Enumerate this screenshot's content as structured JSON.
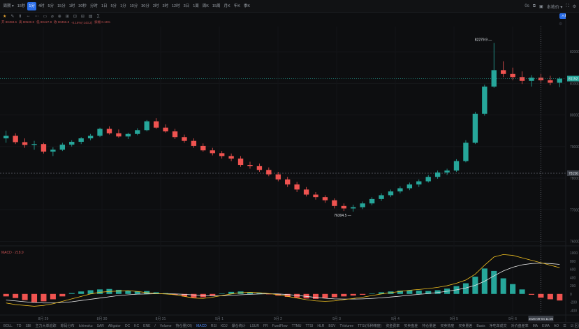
{
  "toolbar": {
    "periods": [
      "周期 ▾",
      "15秒",
      "1分",
      "4时",
      "5分",
      "15分",
      "1时",
      "30秒",
      "分时",
      "1日",
      "5分",
      "1分",
      "10分",
      "30分",
      "2时",
      "3时",
      "12时",
      "3日",
      "1周",
      "周K",
      "15周",
      "月K",
      "年K",
      "季K"
    ],
    "active_index": 2,
    "right_labels": [
      "0s",
      "本地价 ▾"
    ]
  },
  "toolbar2": {
    "items": [
      "★",
      "✎",
      "⬆",
      "↔",
      "⋯",
      "▭",
      "⌀",
      "⊕",
      "⊞",
      "⊡",
      "⊟",
      "▤",
      "∑"
    ]
  },
  "tv_badge": "A 解锁更",
  "legend": {
    "items": [
      "开 80459.6",
      "高 80530.8",
      "低 80427.8",
      "收 80456.8",
      "-0.16%(-143.2)",
      "振幅 0.16%"
    ]
  },
  "chart_data": [
    {
      "type": "candlestick",
      "price_axis": [
        "82000",
        "81000",
        "80000",
        "79000",
        "78000",
        "77000",
        "76000"
      ],
      "ylim": [
        75900,
        82800
      ],
      "x_labels": [
        "8月 29",
        "8月 30",
        "8月 31",
        "9月 1",
        "9月 2",
        "9月 3",
        "9月 4",
        "9月 5",
        "9月 6"
      ],
      "current_price": "81152",
      "reference_price": "78156",
      "high_annotation": "82279.9",
      "low_annotation": "76304.5",
      "crosshair_time": "2026-09-04 11:00",
      "ohlc": [
        [
          79260,
          79500,
          79120,
          79340
        ],
        [
          79340,
          79420,
          79080,
          79140
        ],
        [
          79140,
          79260,
          78960,
          79050
        ],
        [
          79050,
          79180,
          78900,
          79080
        ],
        [
          79080,
          79120,
          78780,
          78840
        ],
        [
          78840,
          78980,
          78700,
          78900
        ],
        [
          78900,
          79120,
          78860,
          79060
        ],
        [
          79060,
          79200,
          79000,
          79150
        ],
        [
          79150,
          79300,
          79080,
          79260
        ],
        [
          79260,
          79400,
          79200,
          79340
        ],
        [
          79340,
          79600,
          79300,
          79560
        ],
        [
          79560,
          79640,
          79380,
          79420
        ],
        [
          79420,
          79540,
          79280,
          79320
        ],
        [
          79320,
          79440,
          79240,
          79400
        ],
        [
          79400,
          79580,
          79360,
          79520
        ],
        [
          79520,
          79840,
          79480,
          79800
        ],
        [
          79800,
          79900,
          79560,
          79600
        ],
        [
          79600,
          79700,
          79440,
          79480
        ],
        [
          79480,
          79560,
          79240,
          79300
        ],
        [
          79300,
          79380,
          79120,
          79180
        ],
        [
          79180,
          79260,
          78960,
          79020
        ],
        [
          79020,
          79100,
          78840,
          78880
        ],
        [
          78880,
          78960,
          78720,
          78790
        ],
        [
          78790,
          78860,
          78620,
          78700
        ],
        [
          78700,
          78780,
          78540,
          78620
        ],
        [
          78620,
          78700,
          78360,
          78420
        ],
        [
          78420,
          78520,
          78300,
          78380
        ],
        [
          78380,
          78460,
          78200,
          78260
        ],
        [
          78260,
          78340,
          78060,
          78120
        ],
        [
          78120,
          78200,
          77900,
          77960
        ],
        [
          77960,
          78040,
          77720,
          77800
        ],
        [
          77800,
          77880,
          77560,
          77640
        ],
        [
          77640,
          77720,
          77420,
          77480
        ],
        [
          77480,
          77560,
          77320,
          77400
        ],
        [
          77400,
          77460,
          77220,
          77300
        ],
        [
          77300,
          77360,
          77040,
          77120
        ],
        [
          77120,
          77200,
          76960,
          77040
        ],
        [
          77040,
          77160,
          76940,
          77080
        ],
        [
          77080,
          77260,
          77020,
          77200
        ],
        [
          77200,
          77400,
          77140,
          77340
        ],
        [
          77340,
          77520,
          77280,
          77460
        ],
        [
          77460,
          77640,
          77400,
          77580
        ],
        [
          77580,
          77740,
          77520,
          77680
        ],
        [
          77680,
          77860,
          77620,
          77800
        ],
        [
          77800,
          77960,
          77720,
          77900
        ],
        [
          77900,
          78100,
          77860,
          78040
        ],
        [
          78040,
          78240,
          77980,
          78180
        ],
        [
          78180,
          78300,
          78100,
          78240
        ],
        [
          78240,
          78600,
          78200,
          78540
        ],
        [
          78540,
          79200,
          78500,
          79120
        ],
        [
          79120,
          80100,
          79080,
          80040
        ],
        [
          80040,
          80960,
          79980,
          80900
        ],
        [
          80900,
          82279.9,
          80860,
          81420
        ],
        [
          81420,
          81700,
          81200,
          81300
        ],
        [
          81300,
          81500,
          81100,
          81200
        ],
        [
          81200,
          81380,
          80980,
          81080
        ],
        [
          81080,
          81260,
          80900,
          81180
        ],
        [
          81180,
          81300,
          81020,
          81100
        ],
        [
          81100,
          81240,
          80940,
          81020
        ],
        [
          81020,
          81200,
          80880,
          81152
        ]
      ]
    },
    {
      "type": "macd",
      "label": "MACD · 218.9",
      "axis": [
        "1000",
        "800",
        "600",
        "400",
        "200",
        "0",
        "-200",
        "-400"
      ],
      "ylim": [
        -480,
        1120
      ],
      "histogram": [
        -60,
        -100,
        -150,
        -200,
        -180,
        -130,
        -60,
        20,
        60,
        90,
        110,
        120,
        100,
        80,
        60,
        70,
        40,
        20,
        -20,
        -60,
        -90,
        -80,
        -40,
        10,
        50,
        60,
        40,
        20,
        -10,
        -40,
        -70,
        -90,
        -110,
        -120,
        -100,
        -80,
        -60,
        -40,
        -20,
        10,
        40,
        60,
        80,
        90,
        80,
        70,
        90,
        130,
        190,
        260,
        420,
        620,
        560,
        380,
        240,
        110,
        -20,
        -90,
        -130,
        -160
      ],
      "dif": [
        -220,
        -260,
        -280,
        -300,
        -280,
        -240,
        -180,
        -120,
        -60,
        0,
        40,
        60,
        70,
        80,
        60,
        30,
        10,
        0,
        -20,
        -60,
        -100,
        -110,
        -80,
        -40,
        0,
        30,
        40,
        30,
        10,
        -20,
        -60,
        -100,
        -140,
        -170,
        -180,
        -170,
        -140,
        -110,
        -80,
        -40,
        0,
        30,
        60,
        90,
        110,
        130,
        160,
        200,
        260,
        340,
        480,
        700,
        900,
        960,
        940,
        880,
        820,
        760,
        700,
        640
      ],
      "dea": [
        -150,
        -170,
        -190,
        -210,
        -220,
        -220,
        -210,
        -190,
        -160,
        -130,
        -100,
        -70,
        -40,
        -20,
        -5,
        0,
        5,
        5,
        0,
        -10,
        -25,
        -40,
        -50,
        -45,
        -35,
        -20,
        -10,
        0,
        5,
        0,
        -15,
        -35,
        -60,
        -85,
        -105,
        -120,
        -125,
        -125,
        -120,
        -110,
        -95,
        -75,
        -55,
        -30,
        -10,
        10,
        35,
        65,
        100,
        145,
        210,
        310,
        440,
        560,
        650,
        710,
        740,
        750,
        740,
        720
      ]
    }
  ],
  "bottom_indicators": [
    "BOLL",
    "TD",
    "SBI",
    "主力大单追踪",
    "筹码分布",
    "Ichimoku",
    "SAR",
    "Alligator",
    "DC",
    "KC",
    "ENE",
    "/",
    "Volume",
    "持仓量(OI)",
    "MACD",
    "RSI",
    "KDJ",
    "爆仓统计",
    "LSUR",
    "FR",
    "FundFlow",
    "TTMU",
    "TTSI",
    "HLR",
    "BSV",
    "TVolume",
    "TTSI(币种精度)",
    "资金费率",
    "买卖盘差",
    "持仓量差",
    "买卖热度",
    "买卖量差",
    "Basis",
    "净吃单成交",
    "对价盘差率",
    "MA",
    "EMA",
    "AO",
    "☰",
    "☑ 区间统计",
    "打赏",
    "△"
  ],
  "bottom_active_index": 14,
  "colors": {
    "up": "#26a69a",
    "down": "#ef5350",
    "macd_dif": "#f0c020",
    "macd_dea": "#e8e8e8",
    "accent": "#2a6de8"
  }
}
